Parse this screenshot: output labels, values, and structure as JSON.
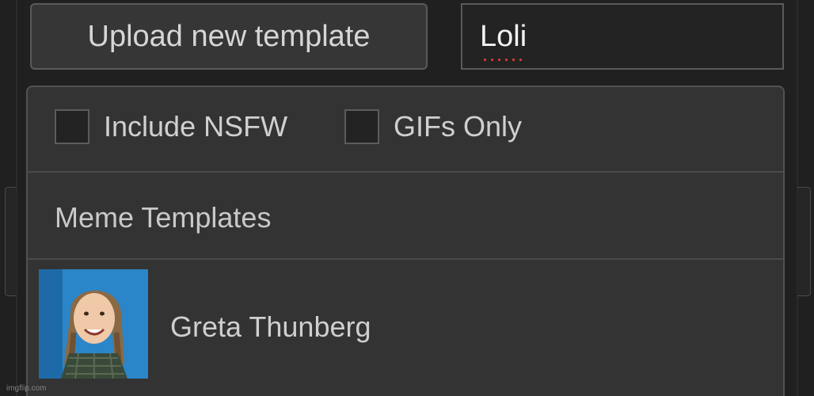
{
  "toolbar": {
    "upload_label": "Upload new template"
  },
  "search": {
    "value": "Loli"
  },
  "filters": {
    "nsfw_label": "Include NSFW",
    "gifs_label": "GIFs Only"
  },
  "list": {
    "header": "Meme Templates",
    "items": [
      {
        "title": "Greta Thunberg"
      }
    ]
  },
  "watermark": "imgflip.com",
  "colors": {
    "background": "#202020",
    "panel": "#333333",
    "border": "#525252",
    "spellcheck": "#d23b3b"
  }
}
